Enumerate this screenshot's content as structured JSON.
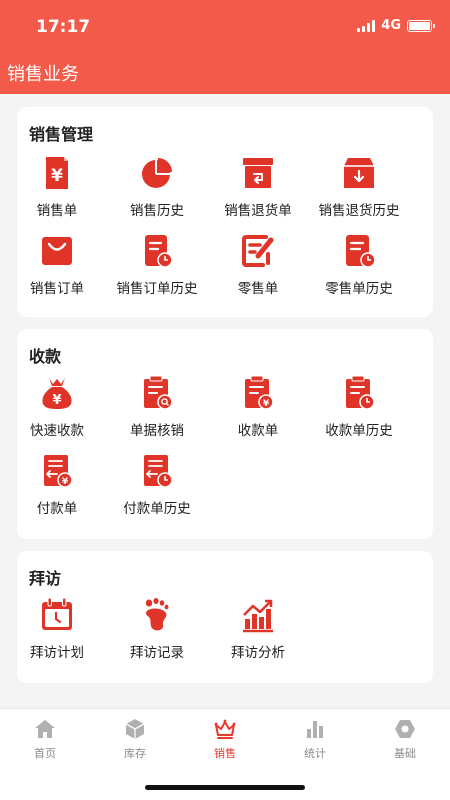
{
  "status_bar": {
    "time": "17:17",
    "network": "4G"
  },
  "header": {
    "title": "销售业务"
  },
  "sections": [
    {
      "title": "销售管理",
      "items": [
        {
          "label": "销售单",
          "icon": "receipt-yen-icon"
        },
        {
          "label": "销售历史",
          "icon": "pie-chart-icon"
        },
        {
          "label": "销售退货单",
          "icon": "return-box-icon"
        },
        {
          "label": "销售退货历史",
          "icon": "inbox-download-icon"
        },
        {
          "label": "销售订单",
          "icon": "shopping-bag-icon"
        },
        {
          "label": "销售订单历史",
          "icon": "document-clock-icon"
        },
        {
          "label": "零售单",
          "icon": "edit-note-icon"
        },
        {
          "label": "零售单历史",
          "icon": "document-clock-icon"
        }
      ]
    },
    {
      "title": "收款",
      "items": [
        {
          "label": "快速收款",
          "icon": "money-bag-icon"
        },
        {
          "label": "单据核销",
          "icon": "clipboard-search-icon"
        },
        {
          "label": "收款单",
          "icon": "clipboard-yen-icon"
        },
        {
          "label": "收款单历史",
          "icon": "clipboard-clock-icon"
        },
        {
          "label": "付款单",
          "icon": "payment-document-icon"
        },
        {
          "label": "付款单历史",
          "icon": "payment-history-icon"
        }
      ]
    },
    {
      "title": "拜访",
      "items": [
        {
          "label": "拜访计划",
          "icon": "calendar-icon"
        },
        {
          "label": "拜访记录",
          "icon": "footprint-icon"
        },
        {
          "label": "拜访分析",
          "icon": "bar-chart-trend-icon"
        }
      ]
    }
  ],
  "tab_bar": {
    "tabs": [
      {
        "label": "首页",
        "icon": "home-icon",
        "active": false
      },
      {
        "label": "库存",
        "icon": "cube-icon",
        "active": false
      },
      {
        "label": "销售",
        "icon": "crown-icon",
        "active": true
      },
      {
        "label": "统计",
        "icon": "bar-chart-icon",
        "active": false
      },
      {
        "label": "基础",
        "icon": "hexagon-icon",
        "active": false
      }
    ]
  },
  "colors": {
    "primary": "#f45a4a",
    "icon_red": "#e03428",
    "tab_active": "#e8392e",
    "tab_inactive": "#b0b0b0"
  }
}
